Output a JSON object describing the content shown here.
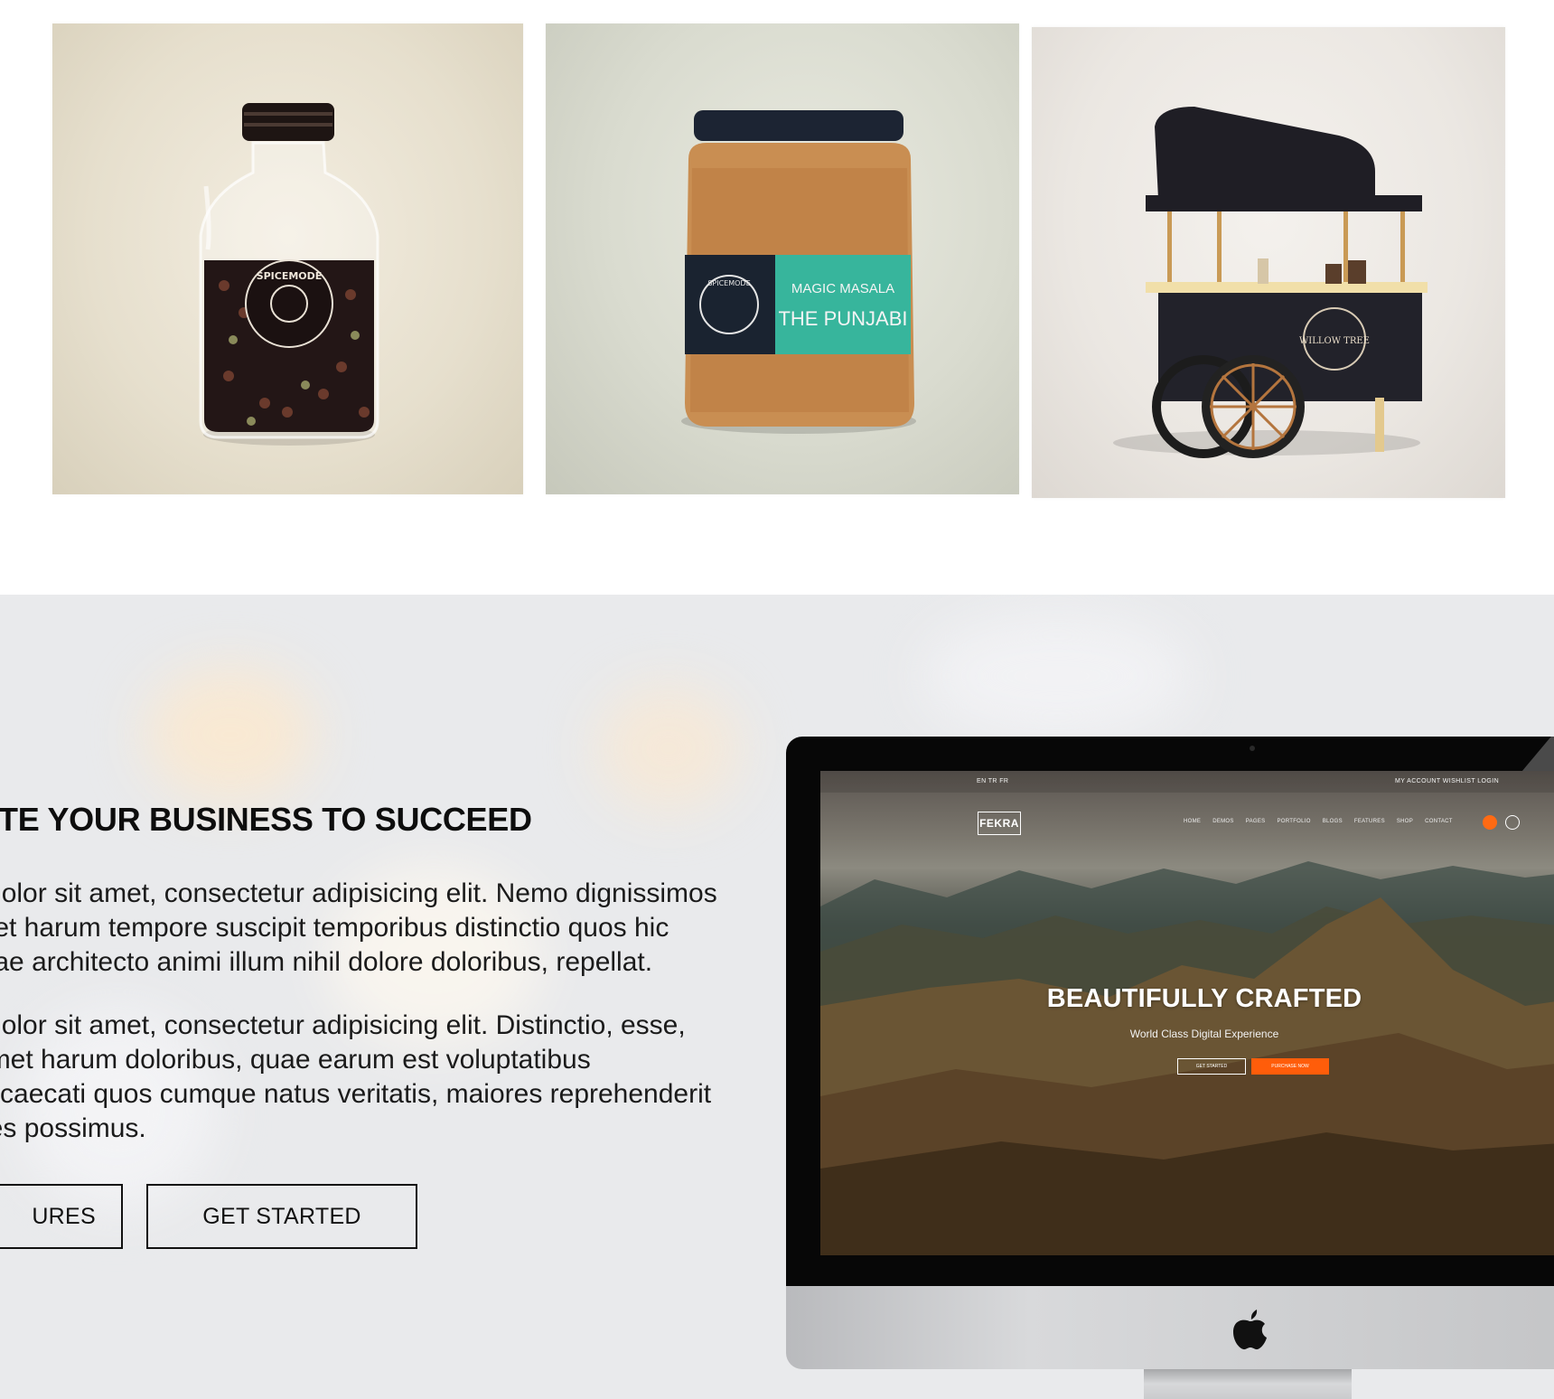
{
  "gallery": {
    "items": [
      {
        "alt": "Spicemode glass bottle",
        "label_text": "SPICEMODE"
      },
      {
        "alt": "Magic Masala jar",
        "label_line1": "MAGIC MASALA",
        "label_line2": "THE PUNJABI",
        "brand": "SPICEMODE"
      },
      {
        "alt": "Willow Tree food cart",
        "sign": "WILLOW TREE"
      }
    ]
  },
  "feature": {
    "heading": "TE YOUR BUSINESS TO SUCCEED",
    "paragraph1": "n dolor sit amet, consectetur adipisicing elit. Nemo dignissimos\nm et harum tempore suscipit temporibus distinctio quos hic\nquae architecto animi illum nihil dolore doloribus, repellat.",
    "paragraph2": "n dolor sit amet, consectetur adipisicing elit. Distinctio, esse,\n Amet harum doloribus, quae earum est voluptatibus\nObcaecati quos cumque natus veritatis, maiores reprehenderit\nores possimus.",
    "button_features": "URES",
    "button_started": "GET STARTED"
  },
  "screen": {
    "lang": "EN   TR   FR",
    "account": "MY ACCOUNT    WISHLIST    LOGIN",
    "logo": "FEKRA",
    "nav": [
      "HOME",
      "DEMOS",
      "PAGES",
      "PORTFOLIO",
      "BLOGS",
      "FEATURES",
      "SHOP",
      "CONTACT"
    ],
    "hero_title": "BEAUTIFULLY CRAFTED",
    "hero_subtitle": "World Class Digital Experience",
    "hero_button1": "GET STARTED",
    "hero_button2": "PURCHASE NOW"
  },
  "colors": {
    "accent": "#ff5d0a",
    "text": "#111111",
    "section_bg": "#e9eaec",
    "masala_label": "#37b59c"
  },
  "icons": {
    "device": "imac-monitor",
    "logo": "apple-icon",
    "cart": "cart-icon",
    "search": "search-icon"
  }
}
